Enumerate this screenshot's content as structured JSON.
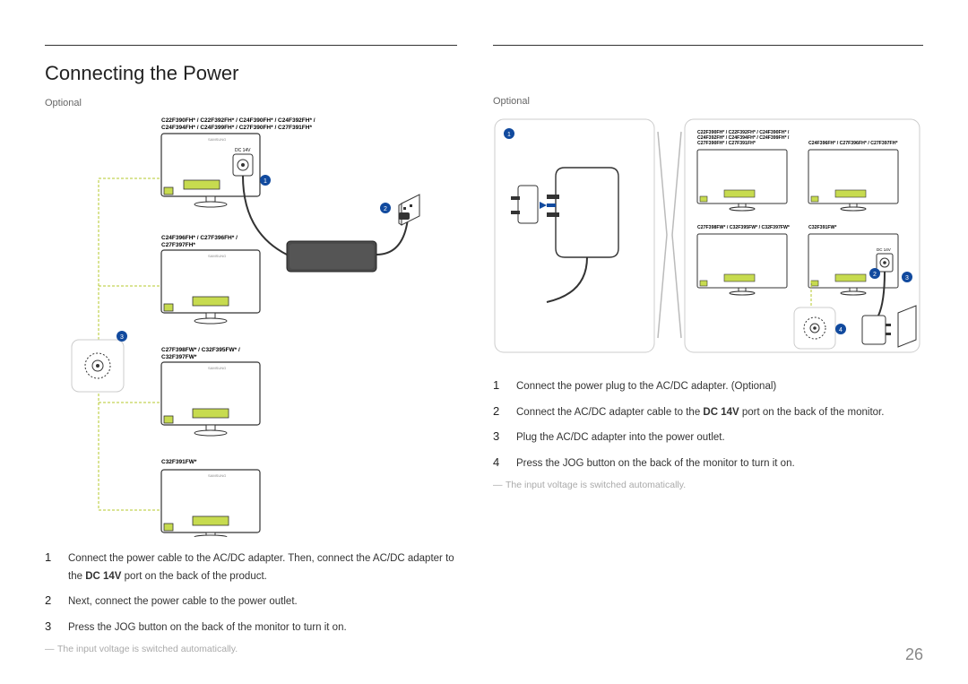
{
  "title": "Connecting the Power",
  "page_number": "26",
  "left": {
    "optional": "Optional",
    "models": {
      "group1": "C22F390FH* / C22F392FH* / C24F390FH* / C24F392FH* / C24F394FH* / C24F399FH* / C27F390FH* / C27F391FH*",
      "group2": "C24F396FH* / C27F396FH* / C27F397FH*",
      "group3": "C27F398FW* / C32F395FW* / C32F397FW*",
      "group4": "C32F391FW*"
    },
    "steps": [
      "Connect the power cable to the AC/DC adapter. Then, connect the AC/DC adapter to the DC 14V port on the back of the product.",
      "Next, connect the power cable to the power outlet.",
      "Press the JOG button on the back of the monitor to turn it on."
    ],
    "note": "The input voltage is switched automatically."
  },
  "right": {
    "optional": "Optional",
    "models": {
      "group1": "C22F390FH* / C22F392FH* / C24F390FH* / C24F392FH* / C24F394FH* / C24F399FH* / C27F390FH* / C27F391FH*",
      "group2": "C24F396FH* / C27F396FH* / C27F397FH*",
      "group3": "C27F398FW* / C32F395FW* / C32F397FW*",
      "group4": "C32F391FW*"
    },
    "steps": [
      "Connect the power plug to the AC/DC adapter. (Optional)",
      "Connect the AC/DC adapter cable to the DC 14V port on the back of the monitor.",
      "Plug the AC/DC adapter into the power outlet.",
      "Press the JOG button on the back of the monitor to turn it on."
    ],
    "note": "The input voltage is switched automatically."
  },
  "port_label": "DC 14V",
  "callouts": [
    "1",
    "2",
    "3",
    "4"
  ]
}
